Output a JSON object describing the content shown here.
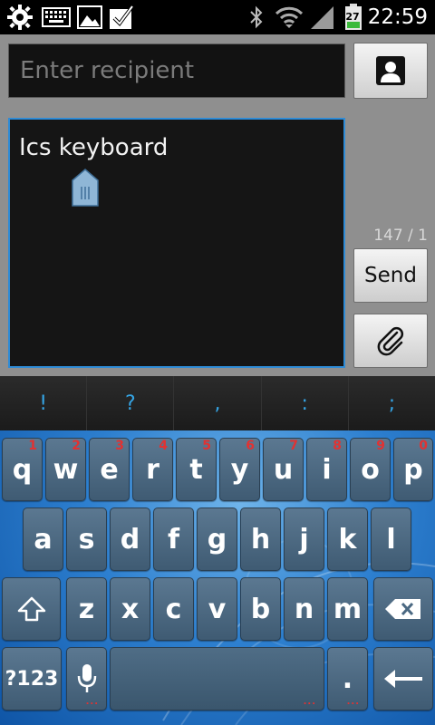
{
  "status_bar": {
    "time": "22:59",
    "battery_level": "27",
    "icons": [
      "settings-gear-icon",
      "keyboard-icon",
      "image-icon",
      "checkbox-icon",
      "bluetooth-icon",
      "wifi-icon",
      "signal-icon",
      "battery-icon"
    ]
  },
  "compose": {
    "recipient_placeholder": "Enter recipient",
    "message_text": "Ics keyboard",
    "char_counter": "147 / 1",
    "send_label": "Send"
  },
  "suggestions": [
    "!",
    "?",
    ",",
    ":",
    ";"
  ],
  "keyboard": {
    "row1": [
      {
        "key": "q",
        "hint": "1"
      },
      {
        "key": "w",
        "hint": "2"
      },
      {
        "key": "e",
        "hint": "3"
      },
      {
        "key": "r",
        "hint": "4"
      },
      {
        "key": "t",
        "hint": "5"
      },
      {
        "key": "y",
        "hint": "6"
      },
      {
        "key": "u",
        "hint": "7"
      },
      {
        "key": "i",
        "hint": "8"
      },
      {
        "key": "o",
        "hint": "9"
      },
      {
        "key": "p",
        "hint": "0"
      }
    ],
    "row2": [
      "a",
      "s",
      "d",
      "f",
      "g",
      "h",
      "j",
      "k",
      "l"
    ],
    "row3": [
      "z",
      "x",
      "c",
      "v",
      "b",
      "n",
      "m"
    ],
    "symbols_label": "?123",
    "period_label": ".",
    "hint_dots": "...",
    "colors": {
      "accent": "#2e8bd6",
      "hint": "#e23232",
      "suggestion": "#35a4e4"
    }
  }
}
